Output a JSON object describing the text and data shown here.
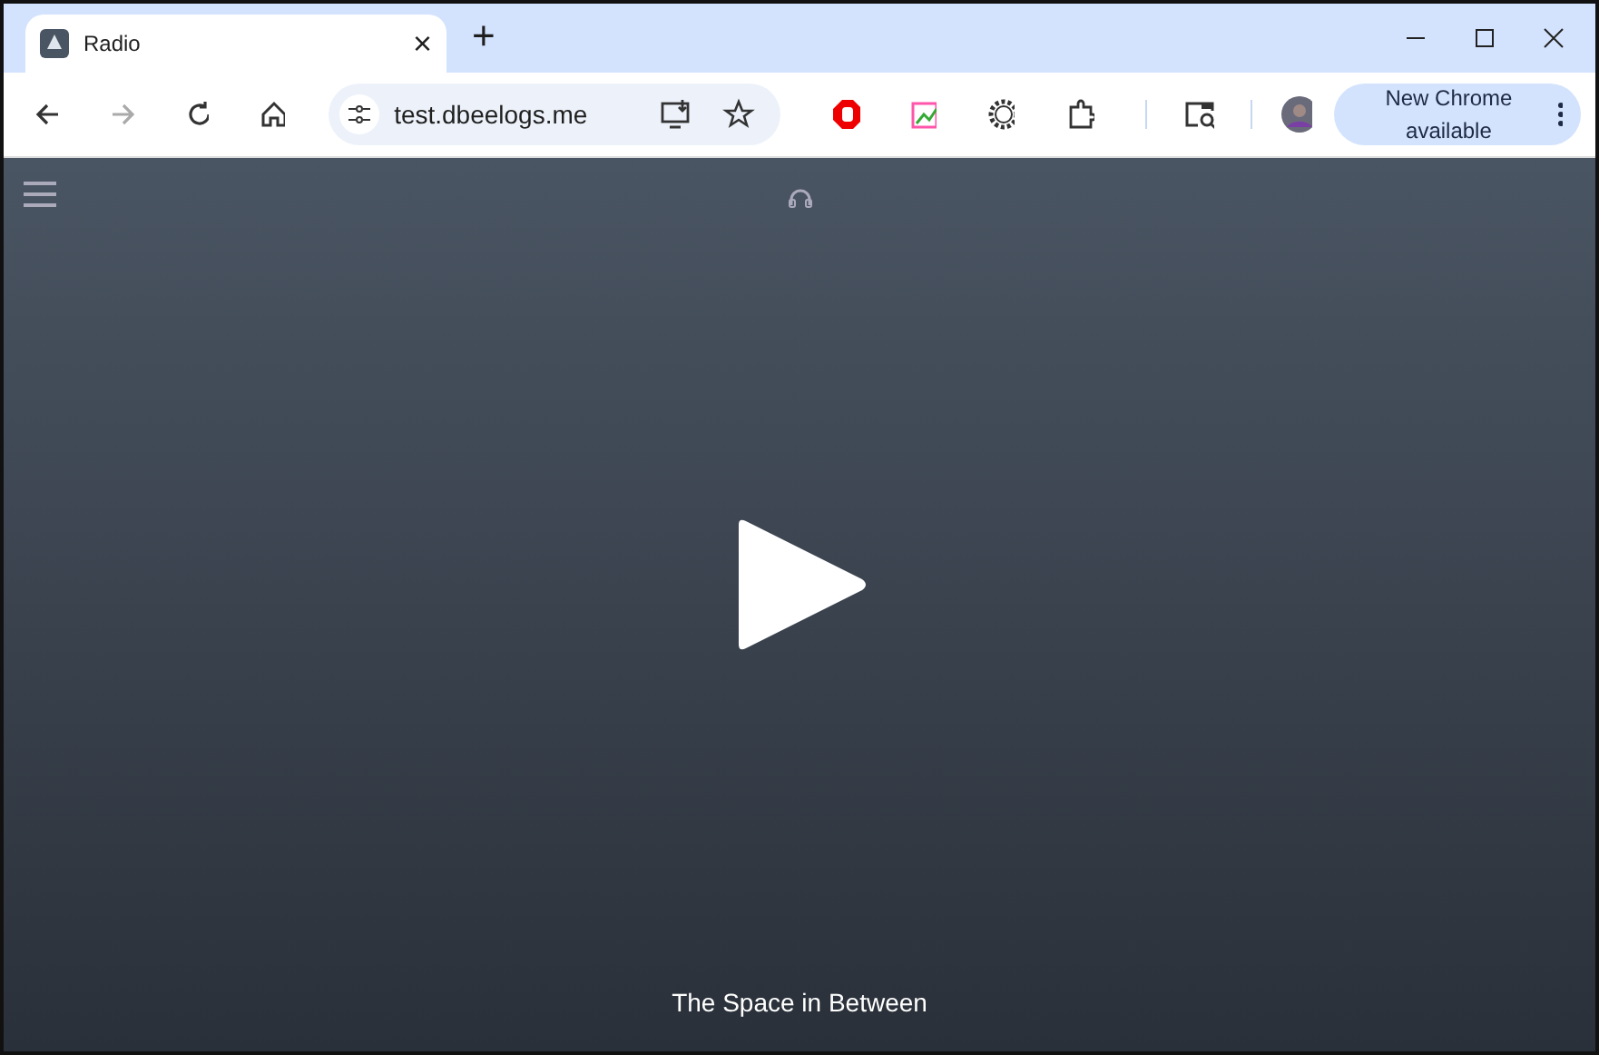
{
  "tab": {
    "title": "Radio",
    "close": "×"
  },
  "new_tab": "+",
  "address": {
    "url": "test.dbeelogs.me"
  },
  "update_button": {
    "label": "New Chrome available"
  },
  "player": {
    "playing": false,
    "track": "The Space in Between"
  }
}
